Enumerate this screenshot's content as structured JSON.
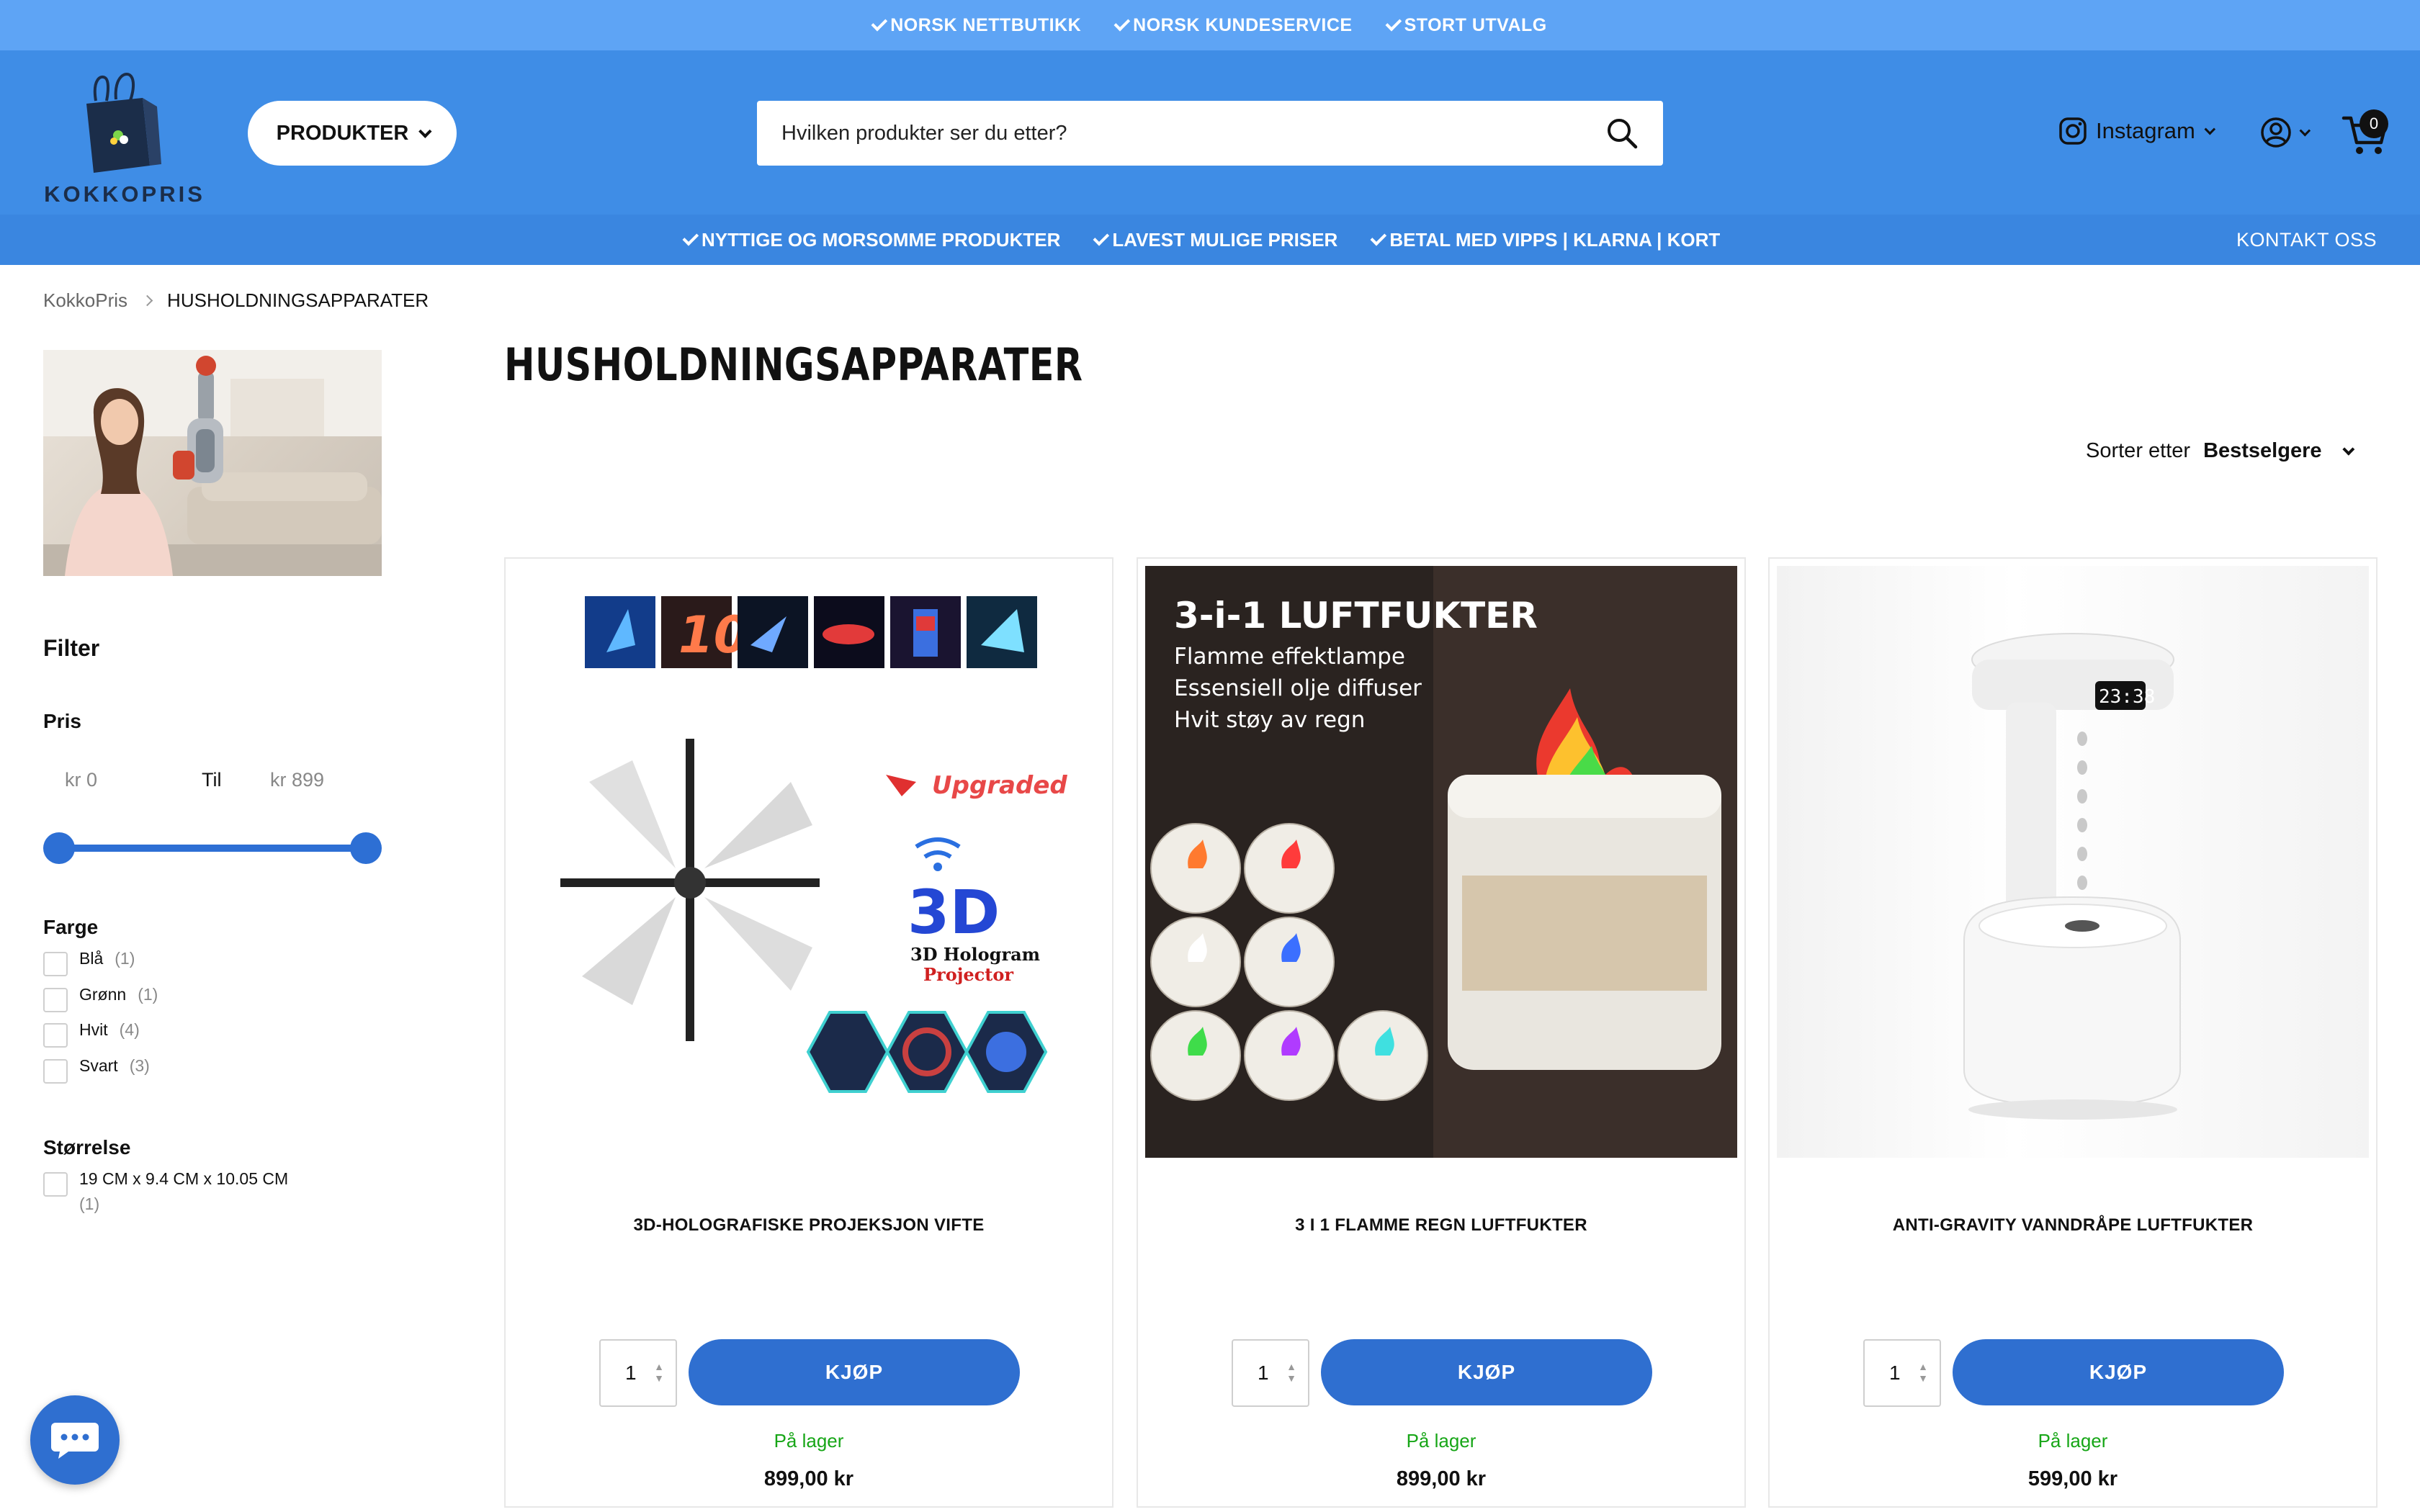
{
  "topbar": {
    "items": [
      "NORSK NETTBUTIKK",
      "NORSK KUNDESERVICE",
      "STORT UTVALG"
    ]
  },
  "header": {
    "logo_text": "KOKKOPRIS",
    "products_label": "PRODUKTER",
    "search_placeholder": "Hvilken produkter ser du etter?",
    "instagram_label": "Instagram",
    "cart_count": "0",
    "icons": [
      "search-icon",
      "instagram-icon",
      "account-icon",
      "cart-icon"
    ]
  },
  "subnav": {
    "items": [
      "NYTTIGE OG MORSOMME PRODUKTER",
      "LAVEST MULIGE PRISER",
      "BETAL MED VIPPS | KLARNA | KORT"
    ],
    "contact": "KONTAKT OSS"
  },
  "breadcrumb": {
    "home": "KokkoPris",
    "current": "HUSHOLDNINGSAPPARATER"
  },
  "sidebar": {
    "filter_title": "Filter",
    "price": {
      "title": "Pris",
      "from": "kr 0",
      "separator": "Til",
      "to": "kr 899",
      "min_fraction": 0,
      "max_fraction": 1
    },
    "color": {
      "title": "Farge",
      "options": [
        {
          "label": "Blå",
          "count": "(1)"
        },
        {
          "label": "Grønn",
          "count": "(1)"
        },
        {
          "label": "Hvit",
          "count": "(4)"
        },
        {
          "label": "Svart",
          "count": "(3)"
        }
      ]
    },
    "size": {
      "title": "Størrelse",
      "options": [
        {
          "label": "19 CM x 9.4 CM x 10.05 CM",
          "count": "(1)"
        }
      ]
    }
  },
  "main": {
    "title": "HUSHOLDNINGSAPPARATER",
    "sort_label": "Sorter etter",
    "sort_value": "Bestselgere",
    "products": [
      {
        "name": "3D-HOLOGRAFISKE PROJEKSJON VIFTE",
        "qty": "1",
        "buy_label": "KJØP",
        "stock": "På lager",
        "price": "899,00 kr",
        "image_text": {
          "badge": "Upgraded",
          "big": "3D",
          "line1": "3D Hologram",
          "line2": "Projector"
        }
      },
      {
        "name": "3 I 1 FLAMME REGN LUFTFUKTER",
        "qty": "1",
        "buy_label": "KJØP",
        "stock": "På lager",
        "price": "899,00 kr",
        "image_text": {
          "title": "3-i-1 LUFTFUKTER",
          "line1": "Flamme effektlampe",
          "line2": "Essensiell olje diffuser",
          "line3": "Hvit støy av regn"
        }
      },
      {
        "name": "ANTI-GRAVITY VANNDRÅPE LUFTFUKTER",
        "qty": "1",
        "buy_label": "KJØP",
        "stock": "På lager",
        "price": "599,00 kr",
        "image_text": {
          "display": "23:38"
        }
      }
    ]
  },
  "colors": {
    "topbar": "#5ea4f5",
    "header": "#3f8de6",
    "subnav": "#3a86e0",
    "button": "#2f6fd0",
    "stock": "#17a617"
  }
}
